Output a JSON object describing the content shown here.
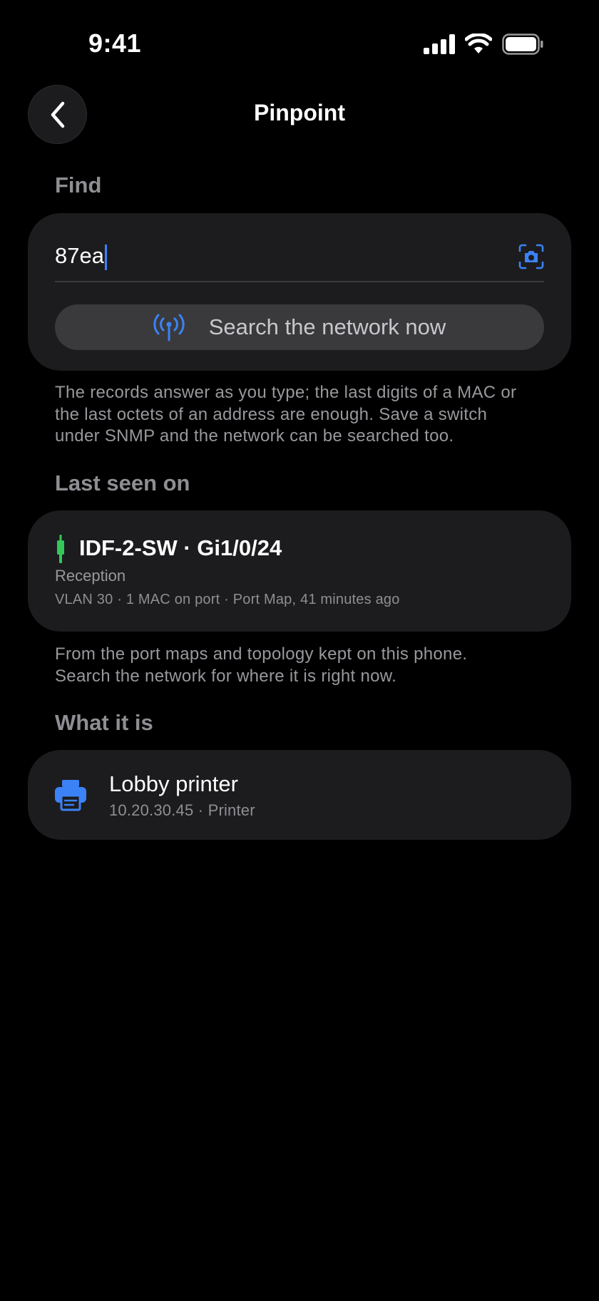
{
  "status_bar": {
    "time": "9:41"
  },
  "nav": {
    "back_icon": "chevron-left-icon",
    "title": "Pinpoint"
  },
  "find": {
    "header": "Find",
    "search_value": "87ea",
    "scan_icon": "camera-scan-icon",
    "search_button_icon": "antenna-icon",
    "search_button_label": "Search the network now",
    "footnote_lines": [
      "The records answer as you type; the last digits of a MAC or",
      "the last octets of an address are enough. Save a switch",
      "under SNMP and the network can be searched too."
    ]
  },
  "last_seen": {
    "header": "Last seen on",
    "port_title": "IDF-2-SW · Gi1/0/24",
    "location": "Reception",
    "meta": "VLAN 30 · 1 MAC on port · Port Map, 41 minutes ago",
    "footnote_lines": [
      "From the port maps and topology kept on this phone.",
      "Search the network for where it is right now."
    ]
  },
  "what_it_is": {
    "header": "What it is",
    "device_icon": "printer-icon",
    "device_name": "Lobby printer",
    "device_meta": "10.20.30.45 · Printer"
  },
  "colors": {
    "background": "#000000",
    "card": "#1c1c1e",
    "accent_blue": "#3b82f6",
    "cable_green": "#34c759",
    "secondary_text": "#8e8e93"
  }
}
